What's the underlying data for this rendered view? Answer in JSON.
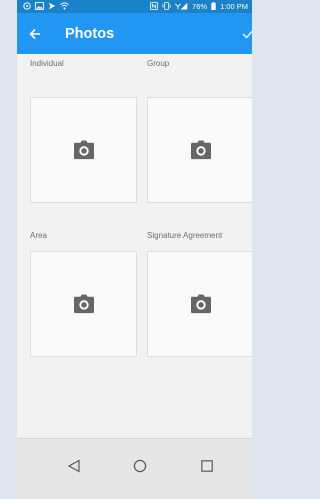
{
  "status_bar": {
    "left_icons": [
      "whatsapp-icon",
      "image-icon",
      "send-icon",
      "wifi-icon"
    ],
    "right_icons": [
      "nfc-icon",
      "vibrate-icon",
      "signal-icon",
      "battery-icon"
    ],
    "battery": "76%",
    "time": "1:00 PM"
  },
  "app_bar": {
    "title": "Photos",
    "back_icon": "arrow-back-icon",
    "confirm_icon": "check-icon"
  },
  "photos": [
    {
      "label": "Individual",
      "icon": "camera-icon"
    },
    {
      "label": "Group",
      "icon": "camera-icon"
    },
    {
      "label": "Area",
      "icon": "camera-icon"
    },
    {
      "label": "Signature Agreement",
      "icon": "camera-icon"
    }
  ],
  "nav_bar": {
    "back": "nav-back-icon",
    "home": "nav-home-icon",
    "recents": "nav-recents-icon"
  },
  "colors": {
    "status_bar": "#1a82c9",
    "app_bar": "#2196f3",
    "content": "#f2f2f2",
    "outer_bg": "#dfe6ee",
    "camera": "#666666"
  }
}
